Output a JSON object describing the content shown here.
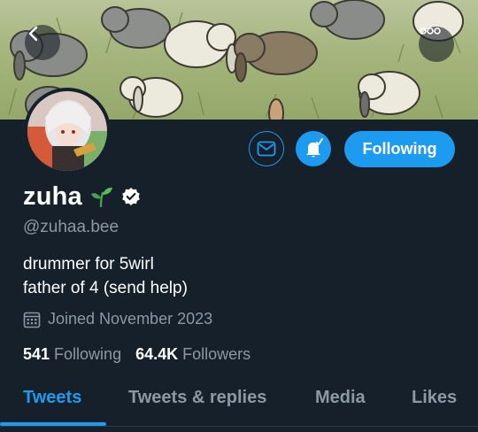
{
  "banner": {
    "back_icon": "chevron-left-icon",
    "more_icon": "more-dots-icon"
  },
  "profile": {
    "display_name": "zuha",
    "handle": "@zuhaa.bee",
    "bio_line1": "drummer for 5wirl",
    "bio_line2": "father of 4 (send help)",
    "joined": "Joined November 2023",
    "following_count": "541",
    "following_label": "Following",
    "followers_count": "64.4K",
    "followers_label": "Followers"
  },
  "actions": {
    "message_icon": "envelope-icon",
    "notify_icon": "bell-check-icon",
    "follow_label": "Following"
  },
  "tabs": [
    {
      "label": "Tweets"
    },
    {
      "label": "Tweets & replies"
    },
    {
      "label": "Media"
    },
    {
      "label": "Likes"
    }
  ],
  "colors": {
    "accent": "#1d9bf0",
    "background": "#15202b",
    "secondary_text": "#8b98a5"
  }
}
